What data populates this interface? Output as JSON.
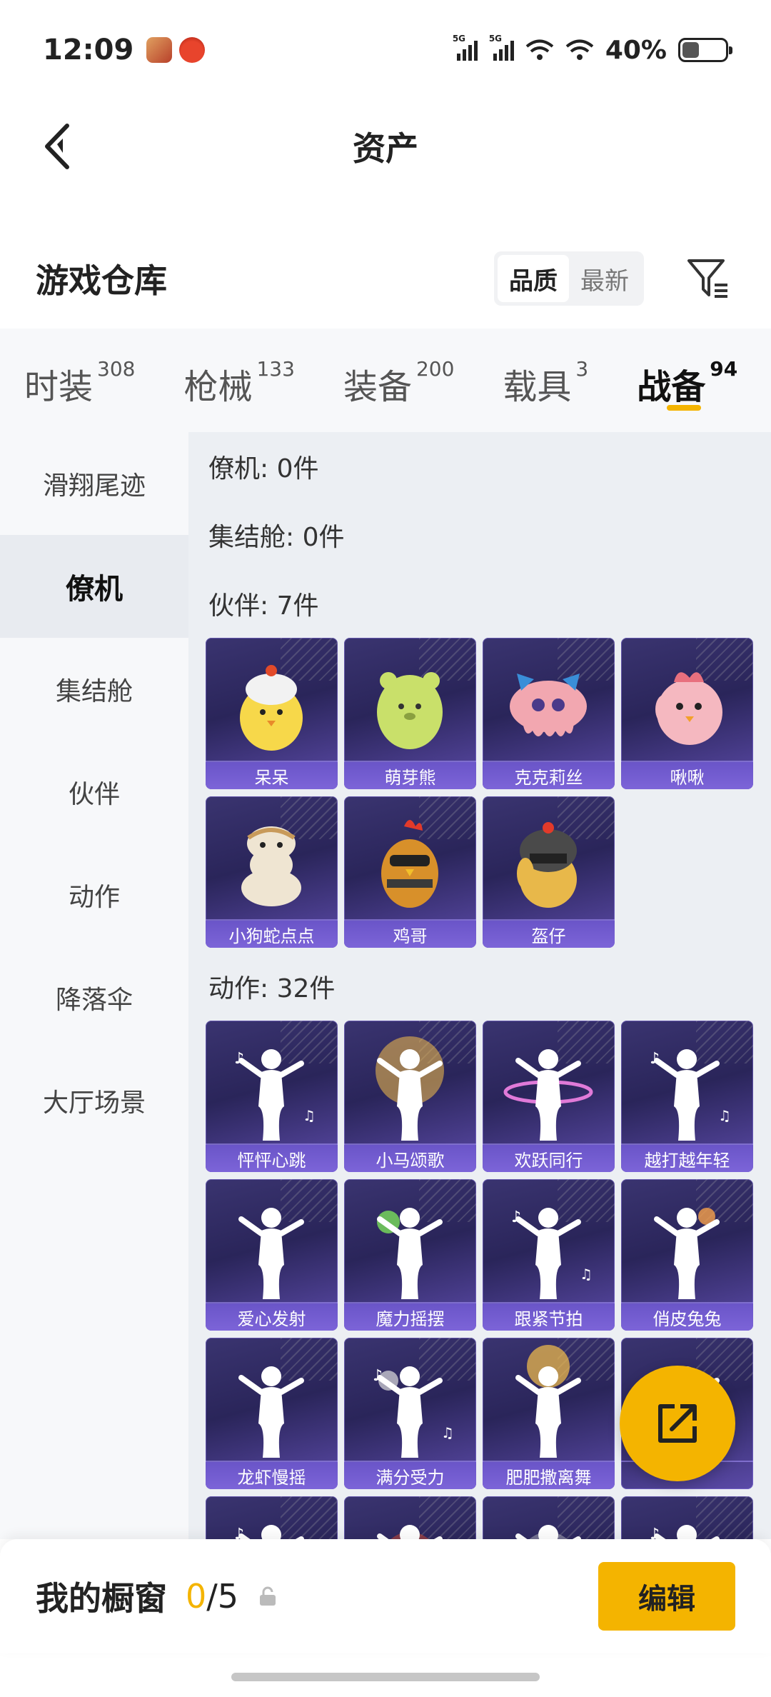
{
  "status_bar": {
    "time": "12:09",
    "battery": "40%",
    "signal_tag_1": "5G",
    "signal_tag_2": "5G"
  },
  "header": {
    "title": "资产"
  },
  "warehouse": {
    "title": "游戏仓库",
    "sort_options": [
      {
        "label": "品质",
        "active": true
      },
      {
        "label": "最新",
        "active": false
      }
    ]
  },
  "tabs": [
    {
      "label": "时装",
      "count": "308"
    },
    {
      "label": "枪械",
      "count": "133"
    },
    {
      "label": "装备",
      "count": "200"
    },
    {
      "label": "载具",
      "count": "3"
    },
    {
      "label": "战备",
      "count": "94",
      "active": true
    }
  ],
  "sidebar": [
    {
      "label": "滑翔尾迹"
    },
    {
      "label": "僚机",
      "active": true
    },
    {
      "label": "集结舱"
    },
    {
      "label": "伙伴"
    },
    {
      "label": "动作"
    },
    {
      "label": "降落伞"
    },
    {
      "label": "大厅场景"
    }
  ],
  "sections": [
    {
      "title": "僚机: 0件",
      "items": []
    },
    {
      "title": "集结舱: 0件",
      "items": []
    },
    {
      "title": "伙伴: 7件",
      "items": [
        "呆呆",
        "萌芽熊",
        "克克莉丝",
        "啾啾",
        "小狗蛇点点",
        "鸡哥",
        "盔仔"
      ]
    },
    {
      "title": "动作: 32件",
      "items": [
        "怦怦心跳",
        "小马颂歌",
        "欢跃同行",
        "越打越年轻",
        "爱心发射",
        "魔力摇摆",
        "跟紧节拍",
        "俏皮兔兔",
        "龙虾慢摇",
        "满分受力",
        "肥肥撒离舞",
        "",
        "",
        "",
        "",
        ""
      ]
    }
  ],
  "bottom_bar": {
    "showcase_label": "我的橱窗",
    "current": "0",
    "separator": "/",
    "total": "5",
    "edit_label": "编辑"
  },
  "colors": {
    "accent": "#f4b400",
    "card_bg": "#2a255a",
    "card_label": "#6a55c8"
  }
}
